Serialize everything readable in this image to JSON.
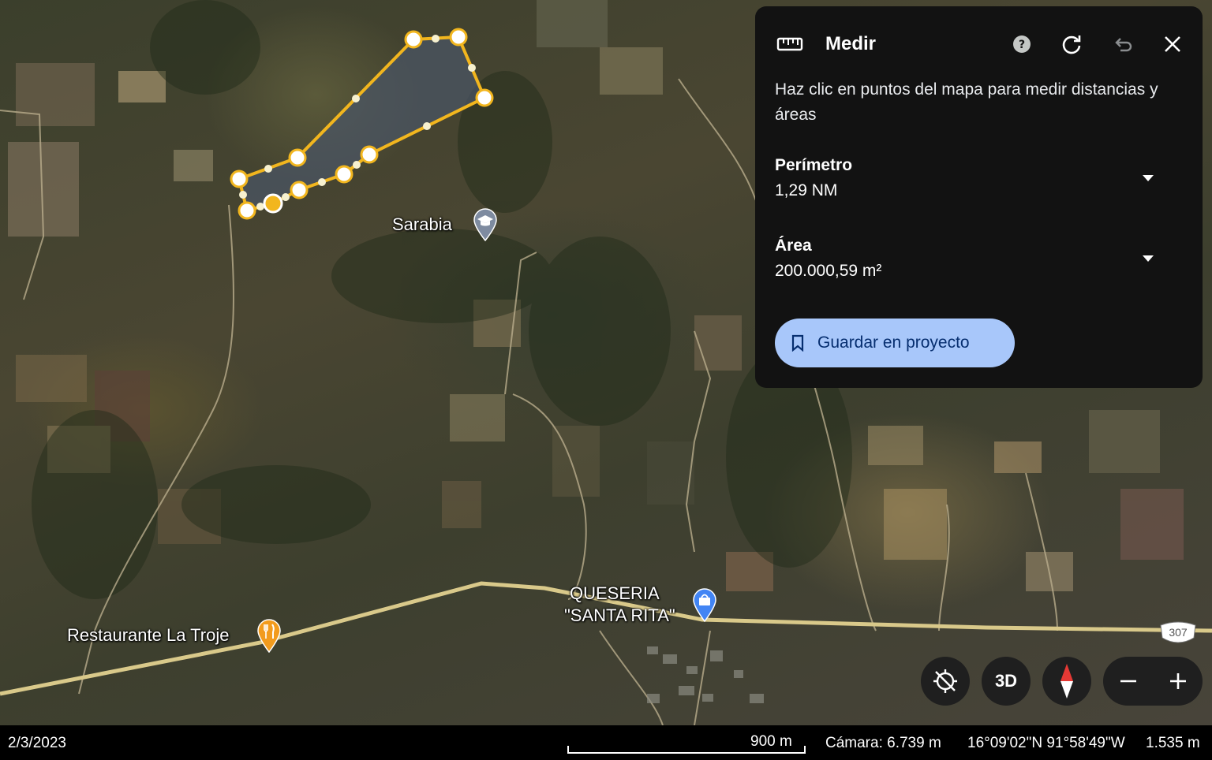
{
  "map": {
    "places": {
      "sarabia": "Sarabia",
      "restaurant": "Restaurante La Troje",
      "queseria_line1": "QUESERIA",
      "queseria_line2": "\"SANTA RITA\"",
      "highway_number": "307"
    },
    "icons": {
      "school": "school-icon",
      "restaurant": "restaurant-icon",
      "shop": "shopping-icon"
    },
    "colors": {
      "measure_line": "#f2b61e",
      "measure_fill": "#4a5566",
      "road": "#d9c98a"
    }
  },
  "panel": {
    "title": "Medir",
    "description": "Haz clic en puntos del mapa para medir distancias y áreas",
    "perimeter_label": "Perímetro",
    "perimeter_value": "1,29 NM",
    "area_label": "Área",
    "area_value": "200.000,59 m²",
    "save_label": "Guardar en proyecto",
    "icons": [
      "ruler-icon",
      "help-icon",
      "refresh-icon",
      "undo-icon",
      "close-icon",
      "chevron-down-icon",
      "bookmark-icon"
    ],
    "save_button_color": "#a8c7fa"
  },
  "controls": {
    "three_d_label": "3D",
    "icons": [
      "location-disabled-icon",
      "compass-icon",
      "zoom-out-icon",
      "zoom-in-icon"
    ]
  },
  "status": {
    "date": "2/3/2023",
    "scale": "900 m",
    "camera": "Cámara: 6.739 m",
    "coords": "16°09'02\"N 91°58'49\"W",
    "elevation": "1.535 m"
  }
}
